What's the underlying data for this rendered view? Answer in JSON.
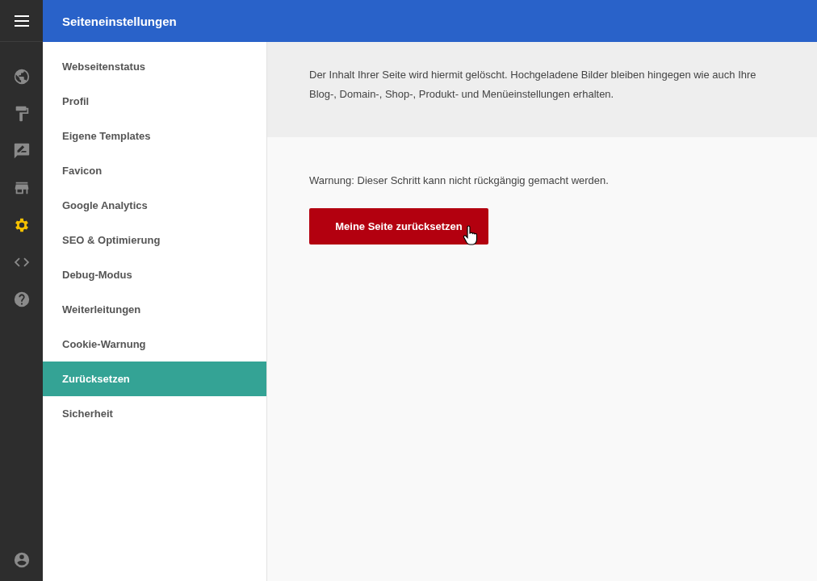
{
  "header": {
    "title": "Seiteneinstellungen"
  },
  "rail": [
    {
      "selected": false
    },
    {
      "selected": false
    },
    {
      "selected": false
    },
    {
      "selected": false
    },
    {
      "selected": true
    },
    {
      "selected": false
    },
    {
      "selected": false
    }
  ],
  "menu": [
    {
      "label": "Webseitenstatus",
      "selected": false
    },
    {
      "label": "Profil",
      "selected": false
    },
    {
      "label": "Eigene Templates",
      "selected": false
    },
    {
      "label": "Favicon",
      "selected": false
    },
    {
      "label": "Google Analytics",
      "selected": false
    },
    {
      "label": "SEO & Optimierung",
      "selected": false
    },
    {
      "label": "Debug-Modus",
      "selected": false
    },
    {
      "label": "Weiterleitungen",
      "selected": false
    },
    {
      "label": "Cookie-Warnung",
      "selected": false
    },
    {
      "label": "Zurücksetzen",
      "selected": true
    },
    {
      "label": "Sicherheit",
      "selected": false
    }
  ],
  "info": "Der Inhalt Ihrer Seite wird hiermit gelöscht. Hochgeladene Bilder bleiben hingegen wie auch Ihre Blog-, Domain-, Shop-, Produkt- und Menüeinstellungen erhalten.",
  "warning": "Warnung: Dieser Schritt kann nicht rückgängig gemacht werden.",
  "reset_button": "Meine Seite zurücksetzen"
}
